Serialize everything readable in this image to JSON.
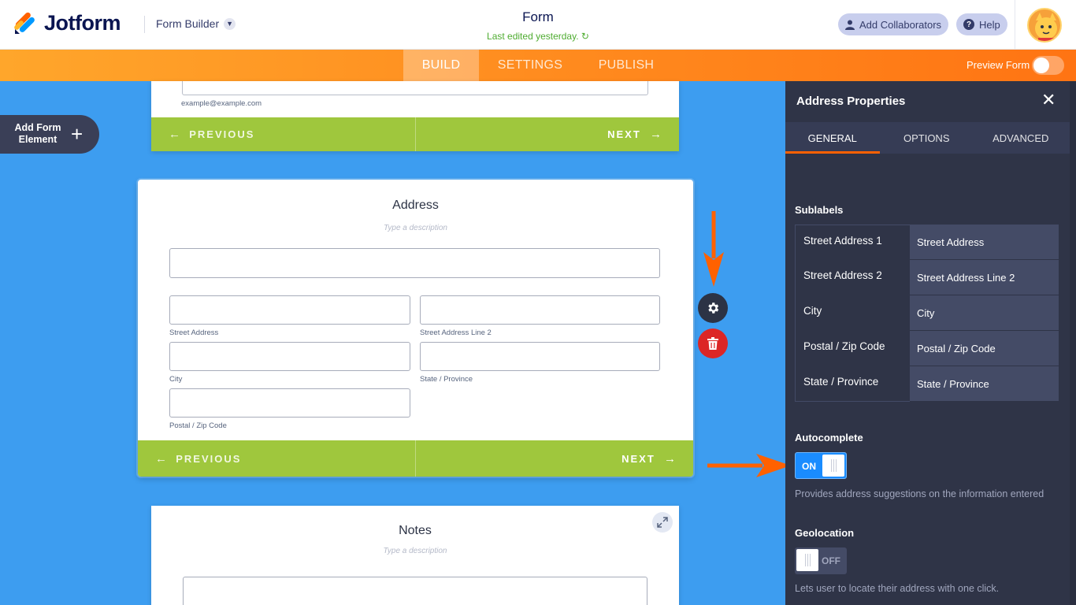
{
  "app": {
    "logo_text": "Jotform",
    "builder_label": "Form Builder",
    "form_title": "Form",
    "last_edited": "Last edited yesterday.",
    "add_collaborators": "Add Collaborators",
    "help": "Help"
  },
  "nav": {
    "tabs": [
      "BUILD",
      "SETTINGS",
      "PUBLISH"
    ],
    "active_tab": "BUILD",
    "preview_label": "Preview Form",
    "preview_on": false
  },
  "canvas": {
    "add_element_label": "Add Form Element",
    "email_sublabel": "example@example.com",
    "previous_label": "PREVIOUS",
    "next_label": "NEXT",
    "address": {
      "title": "Address",
      "description_placeholder": "Type a description",
      "sublabels": {
        "street1": "Street Address",
        "street2": "Street Address Line 2",
        "city": "City",
        "state": "State / Province",
        "postal": "Postal / Zip Code"
      }
    },
    "notes": {
      "title": "Notes",
      "description_placeholder": "Type a description"
    }
  },
  "panel": {
    "title": "Address Properties",
    "tabs": [
      "GENERAL",
      "OPTIONS",
      "ADVANCED"
    ],
    "active_tab": "GENERAL",
    "sublabels_heading": "Sublabels",
    "sublabels": [
      {
        "label": "Street Address 1",
        "value": "Street Address"
      },
      {
        "label": "Street Address 2",
        "value": "Street Address Line 2"
      },
      {
        "label": "City",
        "value": "City"
      },
      {
        "label": "Postal / Zip Code",
        "value": "Postal / Zip Code"
      },
      {
        "label": "State / Province",
        "value": "State / Province"
      }
    ],
    "autocomplete": {
      "heading": "Autocomplete",
      "state_label": "ON",
      "help": "Provides address suggestions on the information entered"
    },
    "geolocation": {
      "heading": "Geolocation",
      "state_label": "OFF",
      "help": "Lets user to locate their address with one click."
    }
  },
  "colors": {
    "canvas_bg": "#3d9df0",
    "nav_orange": "#ff8c1f",
    "nav_bar_green": "#9fc73d",
    "panel_bg": "#2f3447",
    "toggle_on": "#1a8cff",
    "annotation_arrow": "#ff6100",
    "delete_red": "#dc2626"
  }
}
